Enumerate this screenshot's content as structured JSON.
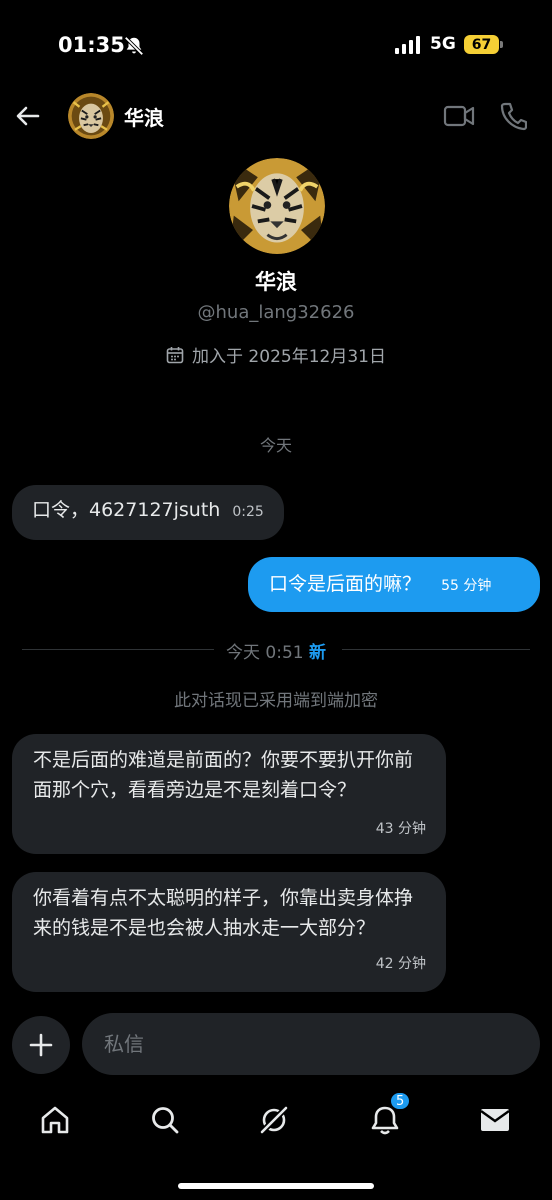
{
  "status_bar": {
    "time": "01:35",
    "network": "5G",
    "battery": "67"
  },
  "header": {
    "name": "华浪"
  },
  "profile": {
    "name": "华浪",
    "handle": "@hua_lang32626",
    "joined": "加入于 2025年12月31日"
  },
  "conversation": {
    "day_label": "今天",
    "messages_before": [
      {
        "direction": "incoming",
        "text": "口令，4627127jsuth",
        "time": "0:25"
      },
      {
        "direction": "outgoing",
        "text": "口令是后面的嘛？",
        "time": "55 分钟"
      }
    ],
    "divider": {
      "label": "今天 0:51",
      "new_label": "新"
    },
    "encryption_notice": "此对话现已采用端到端加密",
    "messages_after": [
      {
        "direction": "incoming",
        "text": "不是后面的难道是前面的？你要不要扒开你前面那个穴，看看旁边是不是刻着口令？",
        "time": "43 分钟"
      },
      {
        "direction": "incoming",
        "text": "你看着有点不太聪明的样子，你靠出卖身体挣来的钱是不是也会被人抽水走一大部分？",
        "time": "42 分钟"
      }
    ]
  },
  "composer": {
    "placeholder": "私信"
  },
  "nav": {
    "items": [
      "home-icon",
      "search-icon",
      "grok-icon",
      "bell-icon",
      "mail-icon"
    ],
    "notification_count": "5"
  },
  "colors": {
    "accent": "#1d9bf0",
    "bubble_in": "#202327",
    "battery": "#f5cf35"
  }
}
